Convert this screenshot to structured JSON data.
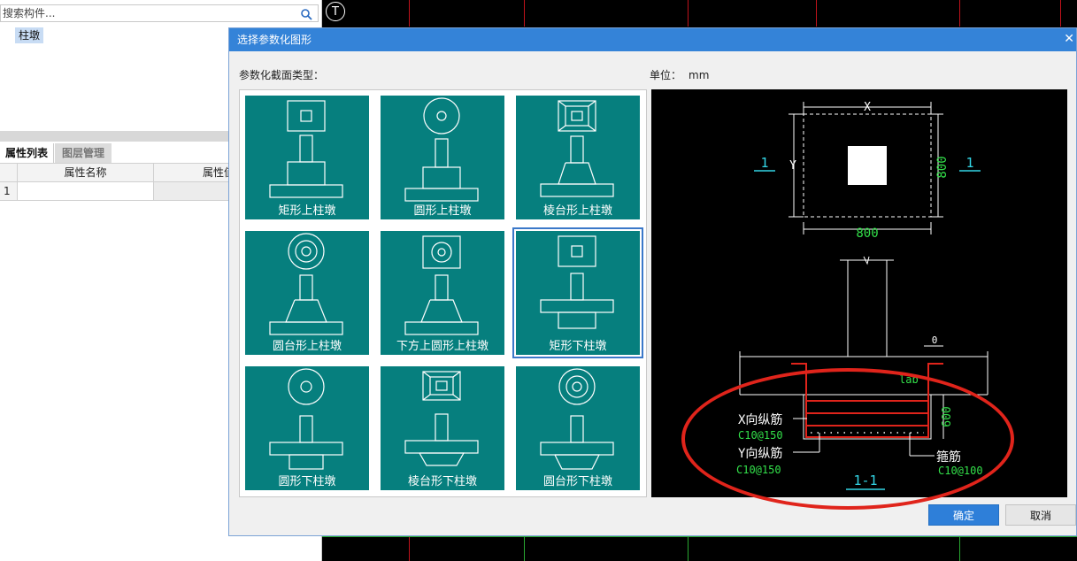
{
  "left_panel": {
    "search_placeholder": "搜索构件...",
    "tree_item": "柱墩",
    "tabs": [
      "属性列表",
      "图层管理"
    ],
    "table": {
      "headers": [
        "属性名称",
        "属性值"
      ],
      "rows": [
        {
          "num": "1",
          "name": "",
          "value": ""
        }
      ]
    }
  },
  "cad": {
    "marker": "T"
  },
  "dialog": {
    "title": "选择参数化图形",
    "section_label": "参数化截面类型：",
    "unit_label": "单位：",
    "unit_value": "mm",
    "shapes": [
      "矩形上柱墩",
      "圆形上柱墩",
      "棱台形上柱墩",
      "圆台形上柱墩",
      "下方上圆形上柱墩",
      "矩形下柱墩",
      "圆形下柱墩",
      "棱台形下柱墩",
      "圆台形下柱墩"
    ],
    "selected_index": 5,
    "preview": {
      "dim_x": "X",
      "dim_y": "Y",
      "dim_side": "800",
      "dim_bottom": "800",
      "section_mark_left": "1",
      "section_mark_right": "1",
      "dim_zero": "0",
      "lab": "lab",
      "dim_600": "600",
      "x_rebar_label": "X向纵筋",
      "x_rebar_value": "C10@150",
      "y_rebar_label": "Y向纵筋",
      "y_rebar_value": "C10@150",
      "stirrup_label": "箍筋",
      "stirrup_value": "C10@100",
      "section_title": "1-1"
    },
    "buttons": {
      "ok": "确定",
      "cancel": "取消"
    }
  },
  "colors": {
    "title_bar": "#3483d8",
    "tile": "#067f7e",
    "dim_green": "#33e04a",
    "mark_cyan": "#33d6e6",
    "rebar_red": "#e0241b"
  }
}
